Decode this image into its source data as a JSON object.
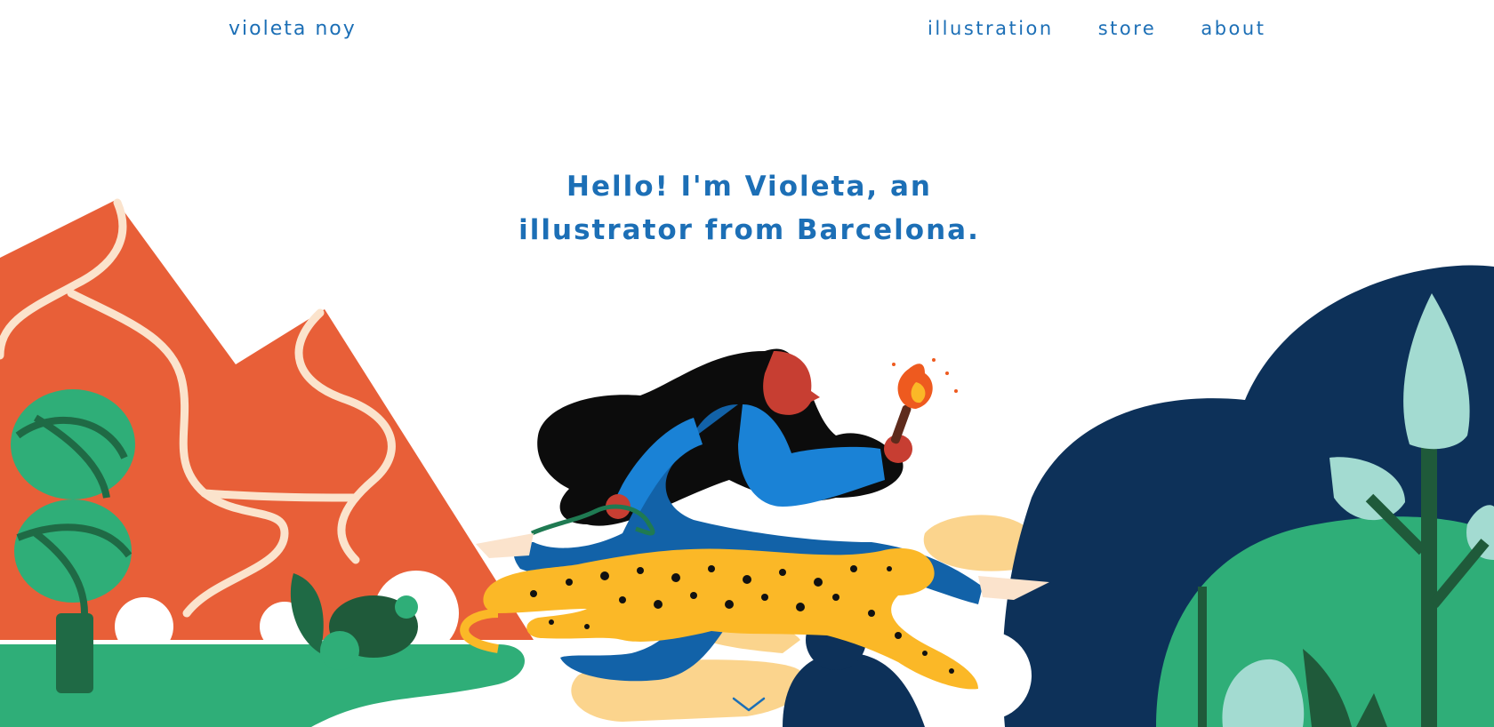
{
  "site": {
    "logo": "violeta noy"
  },
  "nav": {
    "items": [
      {
        "label": "illustration"
      },
      {
        "label": "store"
      },
      {
        "label": "about"
      }
    ]
  },
  "hero": {
    "line1": "Hello! I'm Violeta, an",
    "line2": "illustrator from Barcelona."
  },
  "colors": {
    "brand_blue": "#1c6fb6",
    "mountain_orange": "#e85f38",
    "tree_green": "#2fae78",
    "dark_navy": "#0d3159",
    "leopard_yellow": "#fbb827",
    "sand": "#fbd48d"
  },
  "icons": {
    "scroll": "chevron-down-icon"
  }
}
